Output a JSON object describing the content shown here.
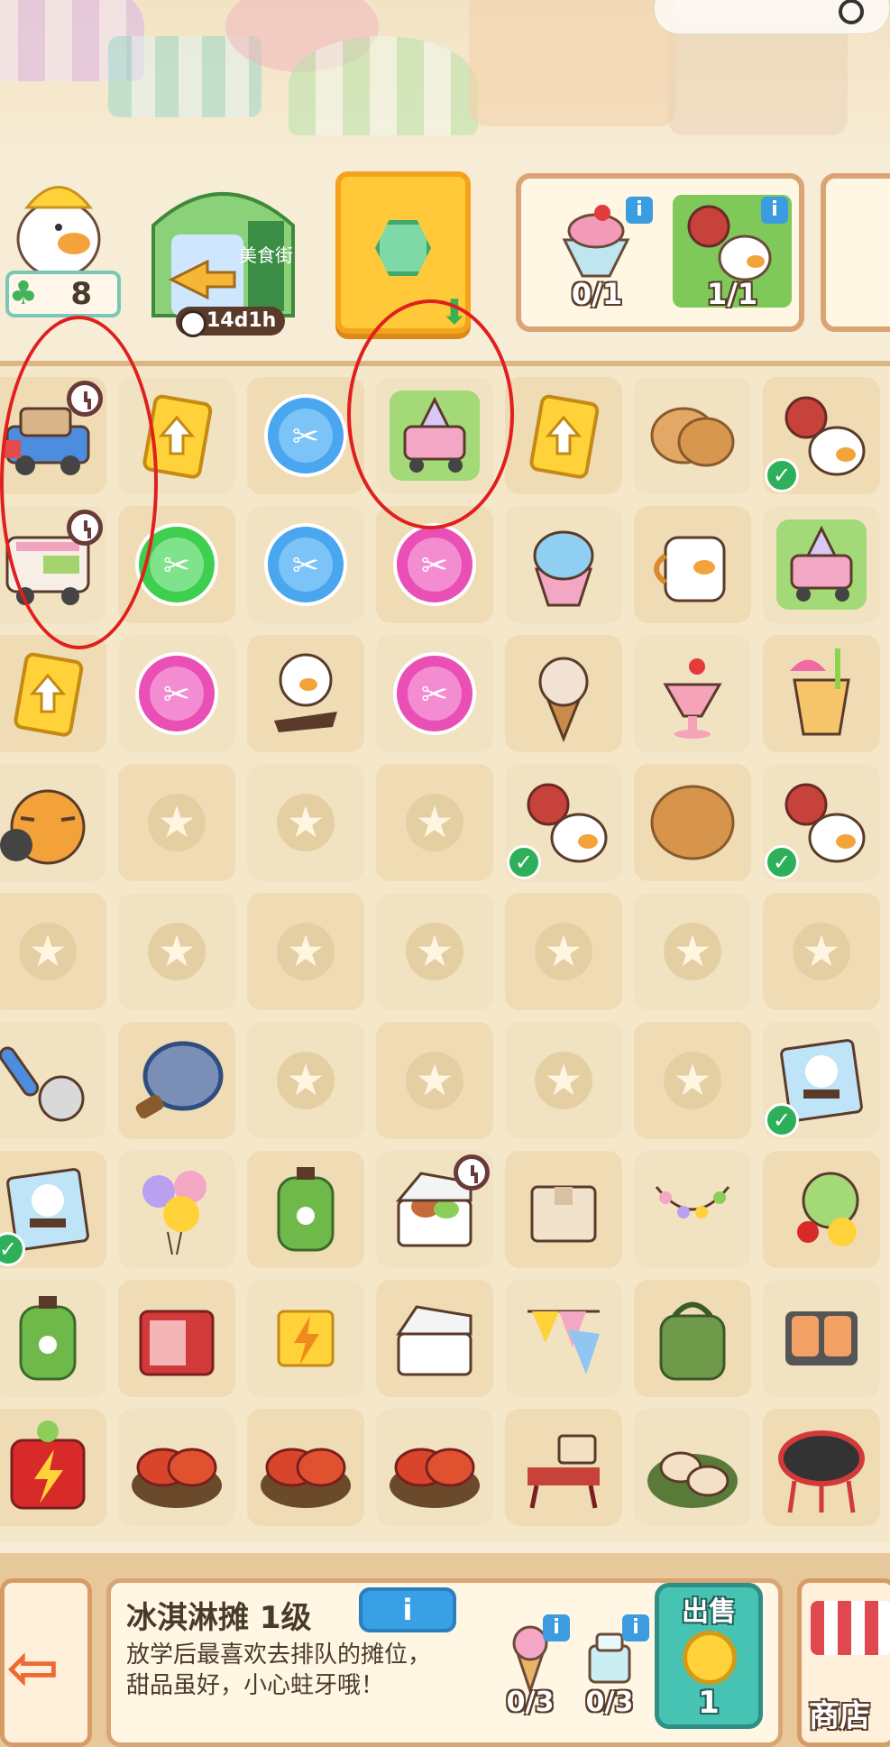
{
  "hud": {
    "level": "8",
    "street_timer": "14d1h",
    "street_sign": "美食街"
  },
  "orders": [
    {
      "name": "strawberry-sundae",
      "count": "0/1"
    },
    {
      "name": "duck-keychain",
      "count": "1/1"
    }
  ],
  "board": {
    "rows": [
      [
        "delivery-truck",
        "upgrade-card",
        "blue-scissors-orb",
        "ice-cream-cart",
        "upgrade-card",
        "pancakes",
        "duck-keychain"
      ],
      [
        "food-truck",
        "green-scissors-orb",
        "blue-scissors-orb",
        "pink-scissors-orb",
        "shaved-ice",
        "duck-mug",
        "ice-cream-cart"
      ],
      [
        "upgrade-card",
        "pink-scissors-orb",
        "duck-hairclip",
        "pink-scissors-orb",
        "ice-cream-cone",
        "cherry-sundae",
        "tropical-drink"
      ],
      [
        "tiger-plush",
        "empty",
        "empty",
        "empty",
        "duck-keychain",
        "flatbread",
        "duck-keychain"
      ],
      [
        "empty",
        "empty",
        "empty",
        "empty",
        "empty",
        "empty",
        "empty"
      ],
      [
        "ice-cream-scoop",
        "frying-pan",
        "empty",
        "empty",
        "empty",
        "empty",
        "duck-photo-card"
      ],
      [
        "duck-photo-card",
        "balloons",
        "gas-canister",
        "takeout-box-food",
        "cardboard-box",
        "light-string",
        "fruit-basket"
      ],
      [
        "gas-canister",
        "mini-fridge",
        "energy-cart",
        "takeout-box-empty",
        "bunting-flags",
        "green-backpack",
        "grilled-skewers"
      ],
      [
        "energy-generator",
        "crayfish-plate",
        "crayfish-plate",
        "crayfish-plate",
        "picnic-table",
        "oyster-plate",
        "bbq-grill"
      ]
    ]
  },
  "selected": {
    "name": "冰淇淋摊 1级",
    "info_label": "i",
    "description": "放学后最喜欢去排队的摊位，甜品虽好，小心蛀牙哦！",
    "requirements": [
      {
        "name": "ice-cream-cone",
        "count": "0/3"
      },
      {
        "name": "ice-cup",
        "count": "0/3"
      }
    ],
    "sell_label": "出售",
    "sell_price": "1"
  },
  "buttons": {
    "shop_label": "商店"
  },
  "colors": {
    "accent_teal": "#47c3b4",
    "gold": "#ffc93a",
    "annotation_red": "#e01f1f",
    "check_green": "#2eb05a"
  }
}
